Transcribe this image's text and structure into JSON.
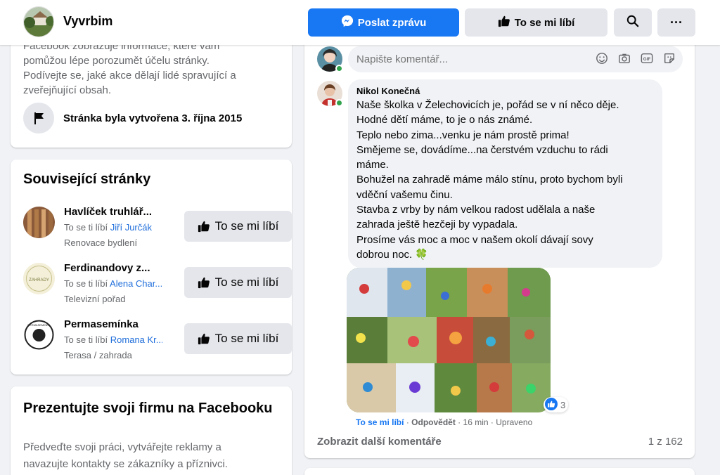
{
  "header": {
    "page_name": "Vyvrbim",
    "send_message": "Poslat zprávu",
    "like": "To se mi líbí",
    "more": "···"
  },
  "about": {
    "text_lines": [
      "Facebook zobrazuje informace, které vám",
      "pomůžou lépe porozumět účelu stránky.",
      "Podívejte se, jaké akce dělají lidé spravující a",
      "zveřejňující obsah."
    ],
    "created": "Stránka byla vytvořena 3. října 2015"
  },
  "related": {
    "title": "Související stránky",
    "like_label": "To se mi líbí",
    "liked_by_prefix": "To se ti líbí",
    "items": [
      {
        "name": "Havlíček truhlář...",
        "liked_by": "Jiří Jurčák",
        "category": "Renovace bydlení"
      },
      {
        "name": "Ferdinandovy z...",
        "liked_by": "Alena Char...",
        "category": "Televizní pořad",
        "thumb_text": "ZAHRADY"
      },
      {
        "name": "Permasemínka",
        "liked_by": "Romana Kr...",
        "category": "Terasa / zahrada",
        "thumb_text": "PERMASEMÍNKA"
      }
    ]
  },
  "promo": {
    "title": "Prezentujte svoji firmu na Facebooku",
    "text_lines": [
      "Předveďte svoji práci, vytvářejte reklamy a",
      "navazujte kontakty se zákazníky a příznivci."
    ]
  },
  "post": {
    "comment_placeholder": "Napište komentář...",
    "input_icons": [
      "emoji-icon",
      "camera-icon",
      "gif-icon",
      "sticker-icon"
    ],
    "comment": {
      "author": "Nikol Konečná",
      "lines": [
        "Naše školka v Želechovicích je, pořád se v ní něco děje.",
        "Hodné dětí máme, to je o nás známé.",
        "Teplo nebo zima...venku je nám prostě prima!",
        "Smějeme se, dovádíme...na čerstvém vzduchu to rádi",
        "máme.",
        "Bohužel na zahradě máme málo stínu, proto bychom byli",
        "vděční vašemu činu.",
        "Stavba z vrby by nám velkou radost udělala a naše",
        "zahrada ještě hezčeji by vypadala.",
        "Prosíme vás moc a moc v našem okolí dávají sovy",
        "dobrou noc. 🍀"
      ],
      "reaction_count": "3",
      "action_like": "To se mi líbí",
      "action_reply": "Odpovědět",
      "time": "16 min",
      "edited": "Upraveno",
      "sep": "·"
    },
    "more_comments": "Zobrazit další komentáře",
    "count": "1 z 162"
  },
  "colors": {
    "primary": "#1877f2",
    "button_gray": "#e4e6eb",
    "online": "#31a24c"
  }
}
